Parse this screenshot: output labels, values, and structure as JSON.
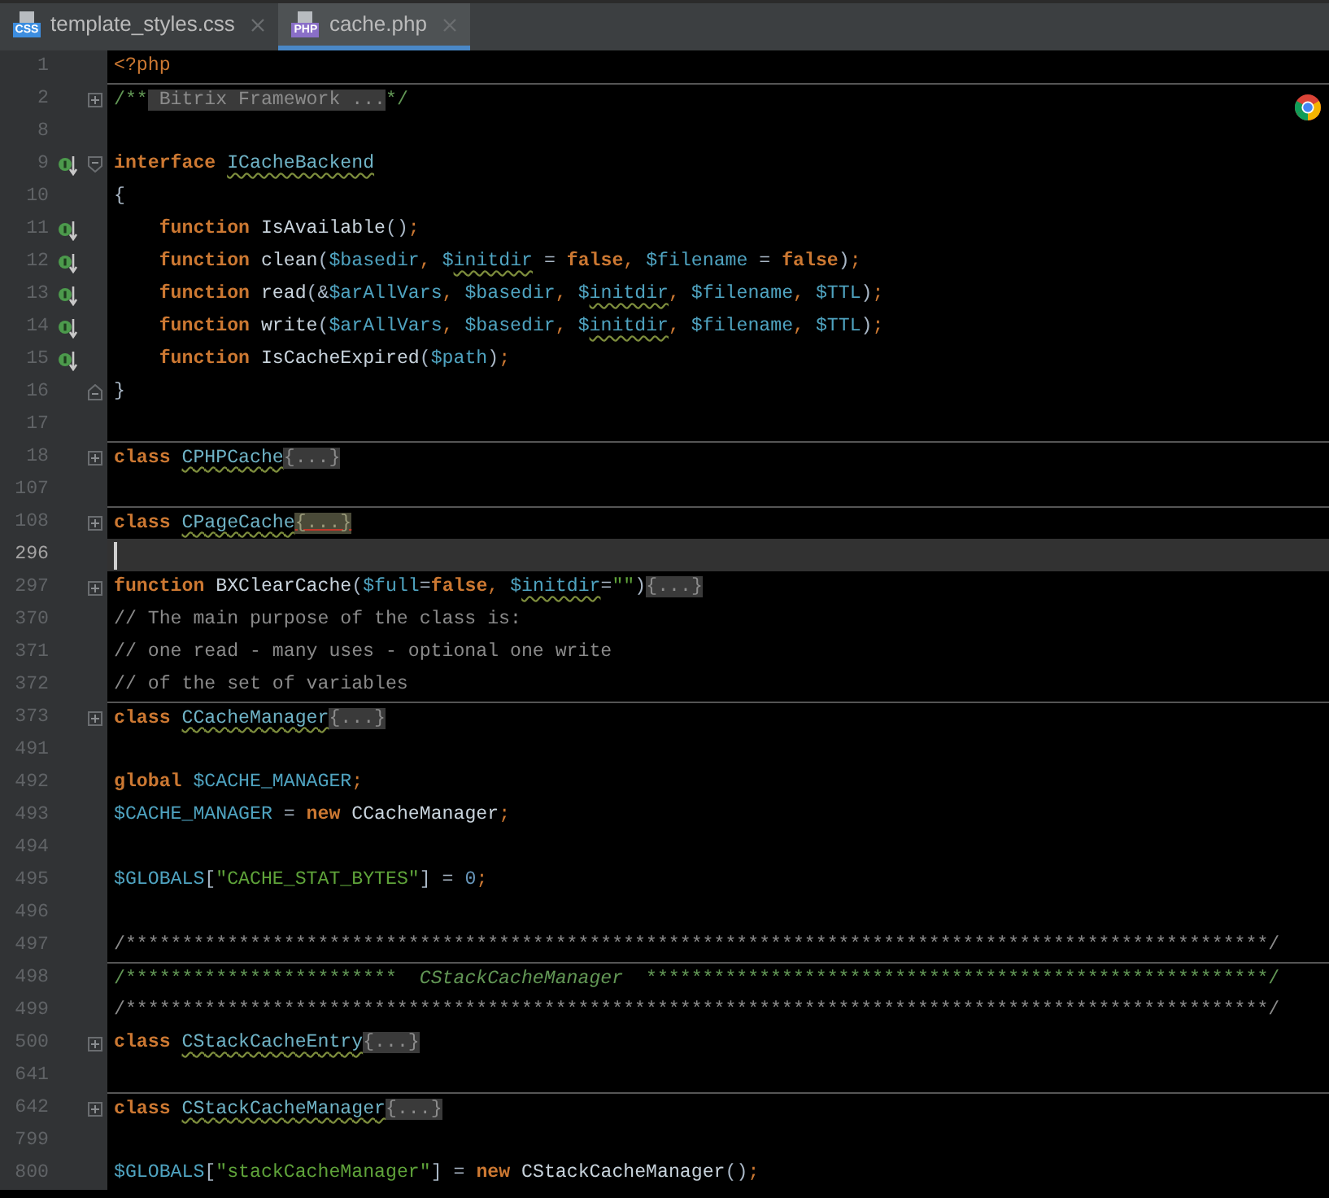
{
  "tabs": [
    {
      "label": "template_styles.css",
      "file_type": "CSS",
      "selected": false
    },
    {
      "label": "cache.php",
      "file_type": "PHP",
      "selected": true
    }
  ],
  "lines": [
    {
      "number": "1",
      "separator_above": false,
      "current": false,
      "tokens": [
        {
          "kind": "tag",
          "text": "<?php"
        }
      ]
    },
    {
      "number": "2",
      "separator_above": true,
      "current": false,
      "collapsed": true,
      "tokens": [
        {
          "kind": "doc",
          "text": "/**"
        },
        {
          "kind": "folded",
          "text": " Bitrix Framework ..."
        },
        {
          "kind": "doc",
          "text": "*/"
        }
      ]
    },
    {
      "number": "8",
      "separator_above": false,
      "current": false
    },
    {
      "number": "9",
      "separator_above": false,
      "current": false,
      "implemented": true,
      "fold_start": true,
      "tokens": [
        {
          "kind": "keyword",
          "text": "interface "
        },
        {
          "kind": "name_typo",
          "text": "ICacheBackend"
        }
      ]
    },
    {
      "number": "10",
      "separator_above": false,
      "current": false,
      "tokens": [
        {
          "kind": "op",
          "text": "{"
        }
      ]
    },
    {
      "number": "11",
      "separator_above": false,
      "current": false,
      "implemented": true,
      "tokens": [
        {
          "kind": "keyword",
          "text": "    function "
        },
        {
          "kind": "fn",
          "text": "IsAvailable"
        },
        {
          "kind": "op",
          "text": "()"
        },
        {
          "kind": "semi",
          "text": ";"
        }
      ]
    },
    {
      "number": "12",
      "separator_above": false,
      "current": false,
      "implemented": true,
      "tokens": [
        {
          "kind": "keyword",
          "text": "    function "
        },
        {
          "kind": "fn",
          "text": "clean"
        },
        {
          "kind": "op",
          "text": "("
        },
        {
          "kind": "var",
          "text": "$basedir"
        },
        {
          "kind": "semi",
          "text": ", "
        },
        {
          "kind": "var",
          "text": "$"
        },
        {
          "kind": "var_typo",
          "text": "initdir"
        },
        {
          "kind": "op",
          "text": " = "
        },
        {
          "kind": "keyword",
          "text": "false"
        },
        {
          "kind": "semi",
          "text": ", "
        },
        {
          "kind": "var",
          "text": "$filename"
        },
        {
          "kind": "op",
          "text": " = "
        },
        {
          "kind": "keyword",
          "text": "false"
        },
        {
          "kind": "op",
          "text": ")"
        },
        {
          "kind": "semi",
          "text": ";"
        }
      ]
    },
    {
      "number": "13",
      "separator_above": false,
      "current": false,
      "implemented": true,
      "tokens": [
        {
          "kind": "keyword",
          "text": "    function "
        },
        {
          "kind": "fn",
          "text": "read"
        },
        {
          "kind": "op",
          "text": "(&"
        },
        {
          "kind": "var",
          "text": "$arAllVars"
        },
        {
          "kind": "semi",
          "text": ", "
        },
        {
          "kind": "var",
          "text": "$basedir"
        },
        {
          "kind": "semi",
          "text": ", "
        },
        {
          "kind": "var",
          "text": "$"
        },
        {
          "kind": "var_typo",
          "text": "initdir"
        },
        {
          "kind": "semi",
          "text": ", "
        },
        {
          "kind": "var",
          "text": "$filename"
        },
        {
          "kind": "semi",
          "text": ", "
        },
        {
          "kind": "var",
          "text": "$TTL"
        },
        {
          "kind": "op",
          "text": ")"
        },
        {
          "kind": "semi",
          "text": ";"
        }
      ]
    },
    {
      "number": "14",
      "separator_above": false,
      "current": false,
      "implemented": true,
      "tokens": [
        {
          "kind": "keyword",
          "text": "    function "
        },
        {
          "kind": "fn",
          "text": "write"
        },
        {
          "kind": "op",
          "text": "("
        },
        {
          "kind": "var",
          "text": "$arAllVars"
        },
        {
          "kind": "semi",
          "text": ", "
        },
        {
          "kind": "var",
          "text": "$basedir"
        },
        {
          "kind": "semi",
          "text": ", "
        },
        {
          "kind": "var",
          "text": "$"
        },
        {
          "kind": "var_typo",
          "text": "initdir"
        },
        {
          "kind": "semi",
          "text": ", "
        },
        {
          "kind": "var",
          "text": "$filename"
        },
        {
          "kind": "semi",
          "text": ", "
        },
        {
          "kind": "var",
          "text": "$TTL"
        },
        {
          "kind": "op",
          "text": ")"
        },
        {
          "kind": "semi",
          "text": ";"
        }
      ]
    },
    {
      "number": "15",
      "separator_above": false,
      "current": false,
      "implemented": true,
      "tokens": [
        {
          "kind": "keyword",
          "text": "    function "
        },
        {
          "kind": "fn",
          "text": "IsCacheExpired"
        },
        {
          "kind": "op",
          "text": "("
        },
        {
          "kind": "var",
          "text": "$path"
        },
        {
          "kind": "op",
          "text": ")"
        },
        {
          "kind": "semi",
          "text": ";"
        }
      ]
    },
    {
      "number": "16",
      "separator_above": false,
      "current": false,
      "fold_end": true,
      "tokens": [
        {
          "kind": "op",
          "text": "}"
        }
      ]
    },
    {
      "number": "17",
      "separator_above": false,
      "current": false
    },
    {
      "number": "18",
      "separator_above": true,
      "current": false,
      "collapsed": true,
      "tokens": [
        {
          "kind": "keyword",
          "text": "class "
        },
        {
          "kind": "name_typo",
          "text": "CPHPCache"
        },
        {
          "kind": "folded",
          "text": "{...}"
        }
      ]
    },
    {
      "number": "107",
      "separator_above": false,
      "current": false
    },
    {
      "number": "108",
      "separator_above": true,
      "current": false,
      "collapsed": true,
      "tokens": [
        {
          "kind": "keyword",
          "text": "class "
        },
        {
          "kind": "name_typo",
          "text": "CPageCache"
        },
        {
          "kind": "folded_match",
          "text": "{...}"
        }
      ]
    },
    {
      "number": "296",
      "separator_above": false,
      "current": true
    },
    {
      "number": "297",
      "separator_above": false,
      "current": false,
      "collapsed": true,
      "tokens": [
        {
          "kind": "keyword",
          "text": "function "
        },
        {
          "kind": "fn",
          "text": "BXClearCache"
        },
        {
          "kind": "op",
          "text": "("
        },
        {
          "kind": "var",
          "text": "$full"
        },
        {
          "kind": "op",
          "text": "="
        },
        {
          "kind": "keyword",
          "text": "false"
        },
        {
          "kind": "semi",
          "text": ", "
        },
        {
          "kind": "var",
          "text": "$"
        },
        {
          "kind": "var_typo",
          "text": "initdir"
        },
        {
          "kind": "op",
          "text": "="
        },
        {
          "kind": "string",
          "text": "\"\""
        },
        {
          "kind": "op",
          "text": ")"
        },
        {
          "kind": "folded",
          "text": "{...}"
        }
      ]
    },
    {
      "number": "370",
      "separator_above": false,
      "current": false,
      "tokens": [
        {
          "kind": "comment",
          "text": "// The main purpose of the class is:"
        }
      ]
    },
    {
      "number": "371",
      "separator_above": false,
      "current": false,
      "tokens": [
        {
          "kind": "comment",
          "text": "// one read - many uses - optional one write"
        }
      ]
    },
    {
      "number": "372",
      "separator_above": false,
      "current": false,
      "tokens": [
        {
          "kind": "comment",
          "text": "// of the set of variables"
        }
      ]
    },
    {
      "number": "373",
      "separator_above": true,
      "current": false,
      "collapsed": true,
      "tokens": [
        {
          "kind": "keyword",
          "text": "class "
        },
        {
          "kind": "name_typo",
          "text": "CCacheManager"
        },
        {
          "kind": "folded",
          "text": "{...}"
        }
      ]
    },
    {
      "number": "491",
      "separator_above": false,
      "current": false
    },
    {
      "number": "492",
      "separator_above": false,
      "current": false,
      "tokens": [
        {
          "kind": "keyword",
          "text": "global "
        },
        {
          "kind": "var",
          "text": "$CACHE_MANAGER"
        },
        {
          "kind": "semi",
          "text": ";"
        }
      ]
    },
    {
      "number": "493",
      "separator_above": false,
      "current": false,
      "tokens": [
        {
          "kind": "var",
          "text": "$CACHE_MANAGER"
        },
        {
          "kind": "op",
          "text": " = "
        },
        {
          "kind": "keyword",
          "text": "new "
        },
        {
          "kind": "fn",
          "text": "CCacheManager"
        },
        {
          "kind": "semi",
          "text": ";"
        }
      ]
    },
    {
      "number": "494",
      "separator_above": false,
      "current": false
    },
    {
      "number": "495",
      "separator_above": false,
      "current": false,
      "tokens": [
        {
          "kind": "var",
          "text": "$GLOBALS"
        },
        {
          "kind": "op",
          "text": "["
        },
        {
          "kind": "string",
          "text": "\"CACHE_STAT_BYTES\""
        },
        {
          "kind": "op",
          "text": "] = "
        },
        {
          "kind": "number",
          "text": "0"
        },
        {
          "kind": "semi",
          "text": ";"
        }
      ]
    },
    {
      "number": "496",
      "separator_above": false,
      "current": false
    },
    {
      "number": "497",
      "separator_above": false,
      "current": false,
      "tokens": [
        {
          "kind": "comment",
          "text": "/*****************************************************************************************************/"
        }
      ]
    },
    {
      "number": "498",
      "separator_above": true,
      "current": false,
      "tokens": [
        {
          "kind": "doc",
          "text": "/************************  "
        },
        {
          "kind": "doc_italic",
          "text": "CStackCacheManager"
        },
        {
          "kind": "doc",
          "text": "  *******************************************************/"
        }
      ]
    },
    {
      "number": "499",
      "separator_above": false,
      "current": false,
      "tokens": [
        {
          "kind": "comment",
          "text": "/*****************************************************************************************************/"
        }
      ]
    },
    {
      "number": "500",
      "separator_above": false,
      "current": false,
      "collapsed": true,
      "tokens": [
        {
          "kind": "keyword",
          "text": "class "
        },
        {
          "kind": "name_typo",
          "text": "CStackCacheEntry"
        },
        {
          "kind": "folded",
          "text": "{...}"
        }
      ]
    },
    {
      "number": "641",
      "separator_above": false,
      "current": false
    },
    {
      "number": "642",
      "separator_above": true,
      "current": false,
      "collapsed": true,
      "tokens": [
        {
          "kind": "keyword",
          "text": "class "
        },
        {
          "kind": "name_typo",
          "text": "CStackCacheManager"
        },
        {
          "kind": "folded",
          "text": "{...}"
        }
      ]
    },
    {
      "number": "799",
      "separator_above": false,
      "current": false
    },
    {
      "number": "800",
      "separator_above": false,
      "current": false,
      "tokens": [
        {
          "kind": "var",
          "text": "$GLOBALS"
        },
        {
          "kind": "op",
          "text": "["
        },
        {
          "kind": "string",
          "text": "\"stackCacheManager\""
        },
        {
          "kind": "op",
          "text": "] = "
        },
        {
          "kind": "keyword",
          "text": "new "
        },
        {
          "kind": "fn",
          "text": "CStackCacheManager"
        },
        {
          "kind": "op",
          "text": "()"
        },
        {
          "kind": "semi",
          "text": ";"
        }
      ]
    }
  ]
}
